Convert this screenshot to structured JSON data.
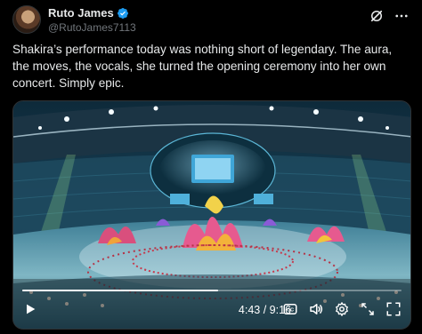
{
  "post": {
    "author_name": "Ruto James",
    "author_handle": "@RutoJames7113",
    "text": "Shakira’s performance today was nothing short of legendary. The aura, the moves, the vocals, she turned the opening ceremony into her own concert. Simply epic."
  },
  "video": {
    "time_display": "4:43 / 9:16",
    "progress": 0.5164,
    "captions_label": "CC"
  },
  "colors": {
    "background": "#000000",
    "text_primary": "#e7e9ea",
    "text_secondary": "#71767b",
    "verified_badge": "#1d9bf0",
    "border": "#2f3336"
  },
  "icons": [
    "verified-badge-icon",
    "grok-icon",
    "more-icon",
    "play-icon",
    "captions-icon",
    "volume-icon",
    "settings-icon",
    "fullscreen-icon",
    "expand-icon"
  ]
}
